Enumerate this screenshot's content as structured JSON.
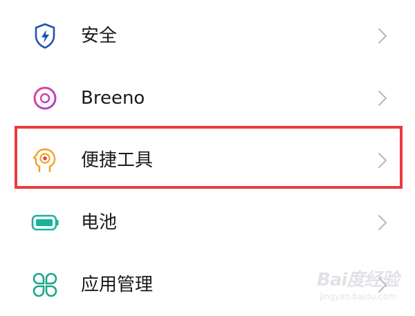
{
  "settings": {
    "items": [
      {
        "label": "安全",
        "icon": "shield-lightning-icon",
        "icon_color": "#1e53b5"
      },
      {
        "label": "Breeno",
        "icon": "breeno-ring-icon",
        "icon_color": "#d9378f"
      },
      {
        "label": "便捷工具",
        "icon": "head-target-icon",
        "icon_color": "#f2a01f"
      },
      {
        "label": "电池",
        "icon": "battery-icon",
        "icon_color": "#19b39c"
      },
      {
        "label": "应用管理",
        "icon": "app-grid-icon",
        "icon_color": "#15a987"
      }
    ],
    "highlighted_index": 2,
    "highlight_color": "#ec3a3f",
    "chevron_color": "#b8b8b8"
  },
  "watermark": {
    "main": "Bai度经验",
    "sub": "jingyan.baidu.com"
  }
}
